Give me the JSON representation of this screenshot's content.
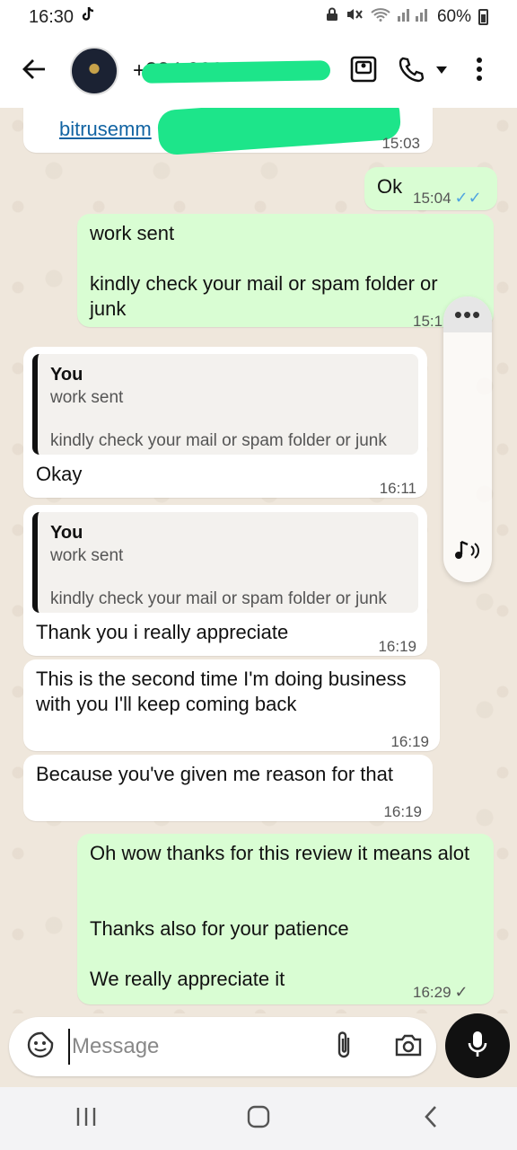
{
  "status_bar": {
    "time": "16:30",
    "battery": "60%"
  },
  "header": {
    "contact_name": "+234 902 453 6442"
  },
  "messages": [
    {
      "id": "m1",
      "direction": "in",
      "text": "bitrusemm",
      "time": "15:03"
    },
    {
      "id": "m2",
      "direction": "out",
      "text": "Ok",
      "time": "15:04",
      "status": "read"
    },
    {
      "id": "m3",
      "direction": "out",
      "line1": "work sent",
      "line2": "kindly check your mail or spam folder or junk",
      "time": "15:1"
    },
    {
      "id": "m4",
      "direction": "in",
      "quote_author": "You",
      "quote_line1": "work sent",
      "quote_line2": "kindly check your mail or spam folder or junk",
      "text": "Okay",
      "time": "16:11"
    },
    {
      "id": "m5",
      "direction": "in",
      "quote_author": "You",
      "quote_line1": "work sent",
      "quote_line2": "kindly check your mail or spam folder or junk",
      "text": "Thank you i really appreciate",
      "time": "16:19"
    },
    {
      "id": "m6",
      "direction": "in",
      "text": "This is the second time I'm doing business with you I'll keep coming back",
      "time": "16:19"
    },
    {
      "id": "m7",
      "direction": "in",
      "text": "Because you've given me reason for that",
      "time": "16:19"
    },
    {
      "id": "m8",
      "direction": "out",
      "line1": "Oh wow thanks for this review it means alot",
      "line2": "Thanks also for your patience",
      "line3": "We really appreciate it",
      "time": "16:29",
      "status": "sent"
    }
  ],
  "composer": {
    "placeholder": "Message"
  },
  "icons": {
    "back": "arrow-left-icon",
    "video": "video-call-icon",
    "call": "phone-icon",
    "more": "more-vertical-icon",
    "emoji": "sticker-icon",
    "attach": "paperclip-icon",
    "camera": "camera-icon",
    "mic": "microphone-icon"
  }
}
